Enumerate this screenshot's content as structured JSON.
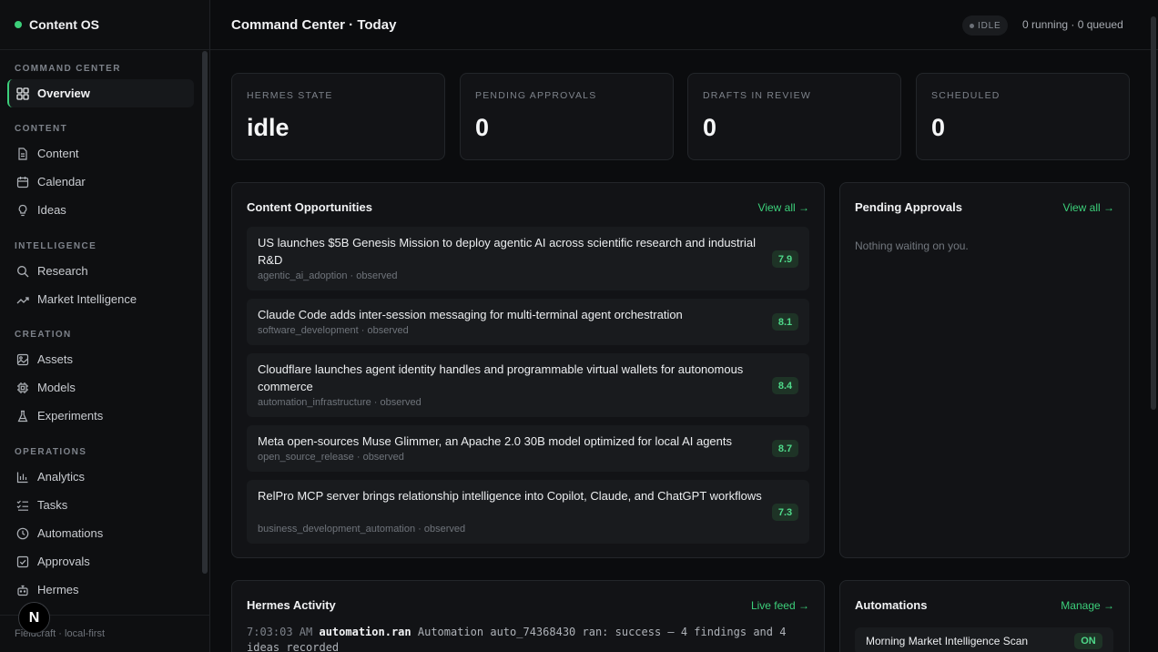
{
  "brand": {
    "name": "Content OS",
    "status_color": "#3ccf7a"
  },
  "sidebar": {
    "sections": [
      {
        "label": "COMMAND CENTER",
        "items": [
          {
            "label": "Overview",
            "icon": "grid-icon",
            "active": true
          }
        ]
      },
      {
        "label": "CONTENT",
        "items": [
          {
            "label": "Content",
            "icon": "document-icon"
          },
          {
            "label": "Calendar",
            "icon": "calendar-icon"
          },
          {
            "label": "Ideas",
            "icon": "lightbulb-icon"
          }
        ]
      },
      {
        "label": "INTELLIGENCE",
        "items": [
          {
            "label": "Research",
            "icon": "search-icon"
          },
          {
            "label": "Market Intelligence",
            "icon": "trend-icon"
          }
        ]
      },
      {
        "label": "CREATION",
        "items": [
          {
            "label": "Assets",
            "icon": "image-icon"
          },
          {
            "label": "Models",
            "icon": "chip-icon"
          },
          {
            "label": "Experiments",
            "icon": "flask-icon"
          }
        ]
      },
      {
        "label": "OPERATIONS",
        "items": [
          {
            "label": "Analytics",
            "icon": "bar-chart-icon"
          },
          {
            "label": "Tasks",
            "icon": "checklist-icon"
          },
          {
            "label": "Automations",
            "icon": "clock-icon"
          },
          {
            "label": "Approvals",
            "icon": "checkbox-icon"
          },
          {
            "label": "Hermes",
            "icon": "robot-icon"
          }
        ]
      }
    ],
    "footer": "Fieldcraft · local-first",
    "badge": "N"
  },
  "header": {
    "title": "Command Center · Today",
    "state_pill": "IDLE",
    "run_status": "0 running · 0 queued"
  },
  "stats": [
    {
      "label": "HERMES STATE",
      "value": "idle"
    },
    {
      "label": "PENDING APPROVALS",
      "value": "0"
    },
    {
      "label": "DRAFTS IN REVIEW",
      "value": "0"
    },
    {
      "label": "SCHEDULED",
      "value": "0"
    }
  ],
  "opportunities": {
    "title": "Content Opportunities",
    "link": "View all →",
    "items": [
      {
        "title": "US launches $5B Genesis Mission to deploy agentic AI across scientific research and industrial R&D",
        "meta": "agentic_ai_adoption · observed",
        "score": "7.9"
      },
      {
        "title": "Claude Code adds inter-session messaging for multi-terminal agent orchestration",
        "meta": "software_development · observed",
        "score": "8.1"
      },
      {
        "title": "Cloudflare launches agent identity handles and programmable virtual wallets for autonomous commerce",
        "meta": "automation_infrastructure · observed",
        "score": "8.4"
      },
      {
        "title": "Meta open-sources Muse Glimmer, an Apache 2.0 30B model optimized for local AI agents",
        "meta": "open_source_release · observed",
        "score": "8.7"
      },
      {
        "title": "RelPro MCP server brings relationship intelligence into Copilot, Claude, and ChatGPT workflows",
        "meta": "business_development_automation · observed",
        "score": "7.3"
      }
    ]
  },
  "approvals": {
    "title": "Pending Approvals",
    "link": "View all →",
    "empty": "Nothing waiting on you."
  },
  "activity": {
    "title": "Hermes Activity",
    "link": "Live feed →",
    "entry": {
      "time": "7:03:03 AM",
      "event": "automation.ran",
      "text": "Automation auto_74368430 ran: success — 4 findings and 4 ideas recorded"
    }
  },
  "automations": {
    "title": "Automations",
    "link": "Manage →",
    "items": [
      {
        "name": "Morning Market Intelligence Scan",
        "state": "ON"
      }
    ]
  }
}
